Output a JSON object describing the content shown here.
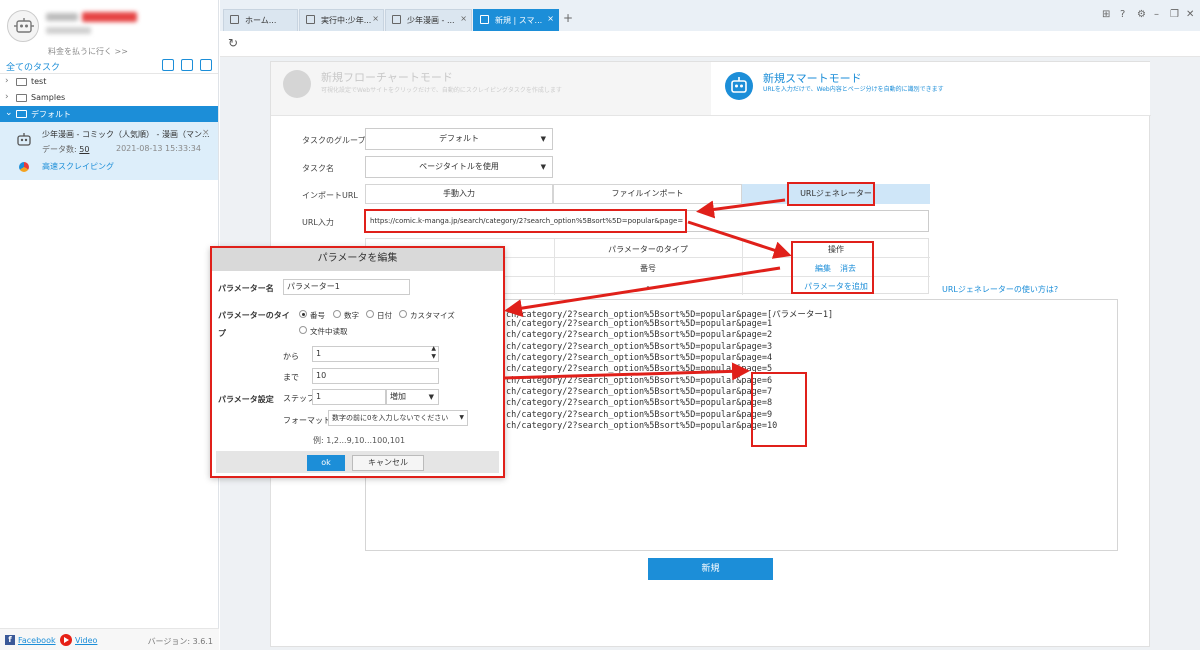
{
  "sidebar": {
    "pay_link": "料金を払うに行く >>",
    "all_tasks": "全てのタスク",
    "folders": [
      {
        "label": "test"
      },
      {
        "label": "Samples"
      },
      {
        "label": "デフォルト"
      }
    ],
    "task": {
      "title": "少年漫画 - コミック（人気順） - 漫画（マン...",
      "count_label": "データ数:",
      "count": "50",
      "time": "2021-08-13 15:33:34",
      "speed_label": "高速スクレイピング"
    },
    "footer": {
      "facebook": "Facebook",
      "video": "Video",
      "version": "バージョン: 3.6.1"
    }
  },
  "tabs": [
    {
      "label": "ホーム..."
    },
    {
      "label": "実行中:少年..."
    },
    {
      "label": "少年漫画 - ..."
    },
    {
      "label": "新規 | スマ..."
    }
  ],
  "modes": {
    "flow": {
      "title": "新規フローチャートモード",
      "subtitle": "可視化設定でWebサイトをクリックだけで、自動的にスクレイピングタスクを作成します"
    },
    "smart": {
      "title": "新規スマートモード",
      "subtitle": "URLを入力だけで、Web内容とページ分けを自動的に識別できます"
    }
  },
  "form": {
    "group_label": "タスクのグループ",
    "group_value": "デフォルト",
    "name_label": "タスク名",
    "name_value": "ページタイトルを使用",
    "import_label": "インポートURL",
    "seg_manual": "手動入力",
    "seg_file": "ファイルインポート",
    "seg_gen": "URLジェネレーター",
    "url_label": "URL入力",
    "url_value": "https://comic.k-manga.jp/search/category/2?search_option%5Bsort%5D=popular&page=",
    "col_type": "パラメーターのタイプ",
    "col_ops": "操作",
    "row_type": "番号",
    "row_range": "-",
    "op_edit": "編集",
    "op_delete": "消去",
    "add_param": "パラメータを追加",
    "howto": "URLジェネレーターの使い方は?",
    "create": "新規"
  },
  "url_list": [
    "ch/category/2?search_option%5Bsort%5D=popular&page=[パラメーター1]",
    "ch/category/2?search_option%5Bsort%5D=popular&page=1",
    "ch/category/2?search_option%5Bsort%5D=popular&page=2",
    "ch/category/2?search_option%5Bsort%5D=popular&page=3",
    "ch/category/2?search_option%5Bsort%5D=popular&page=4",
    "ch/category/2?search_option%5Bsort%5D=popular&page=5",
    "ch/category/2?search_option%5Bsort%5D=popular&page=6",
    "ch/category/2?search_option%5Bsort%5D=popular&page=7",
    "ch/category/2?search_option%5Bsort%5D=popular&page=8",
    "ch/category/2?search_option%5Bsort%5D=popular&page=9",
    "ch/category/2?search_option%5Bsort%5D=popular&page=10"
  ],
  "dialog": {
    "title": "パラメータを編集",
    "name_label": "パラメーター名",
    "name_value": "パラメーター1",
    "type_label": "パラメーターのタイ",
    "type_label_2": "プ",
    "types": [
      "番号",
      "数字",
      "日付",
      "カスタマイズ",
      "文件中读取"
    ],
    "from_label": "から",
    "from_value": "1",
    "to_label": "まで",
    "to_value": "10",
    "settings_label": "パラメータ設定",
    "step_label": "ステップ",
    "step_value": "1",
    "step_dir": "増加",
    "format_label": "フォーマット",
    "format_value": "数字の前に0を入力しないでください",
    "example": "例: 1,2...9,10...100,101",
    "ok": "ok",
    "cancel": "キャンセル"
  },
  "colors": {
    "accent": "#1c8ed8",
    "annotation": "#e0201a"
  }
}
